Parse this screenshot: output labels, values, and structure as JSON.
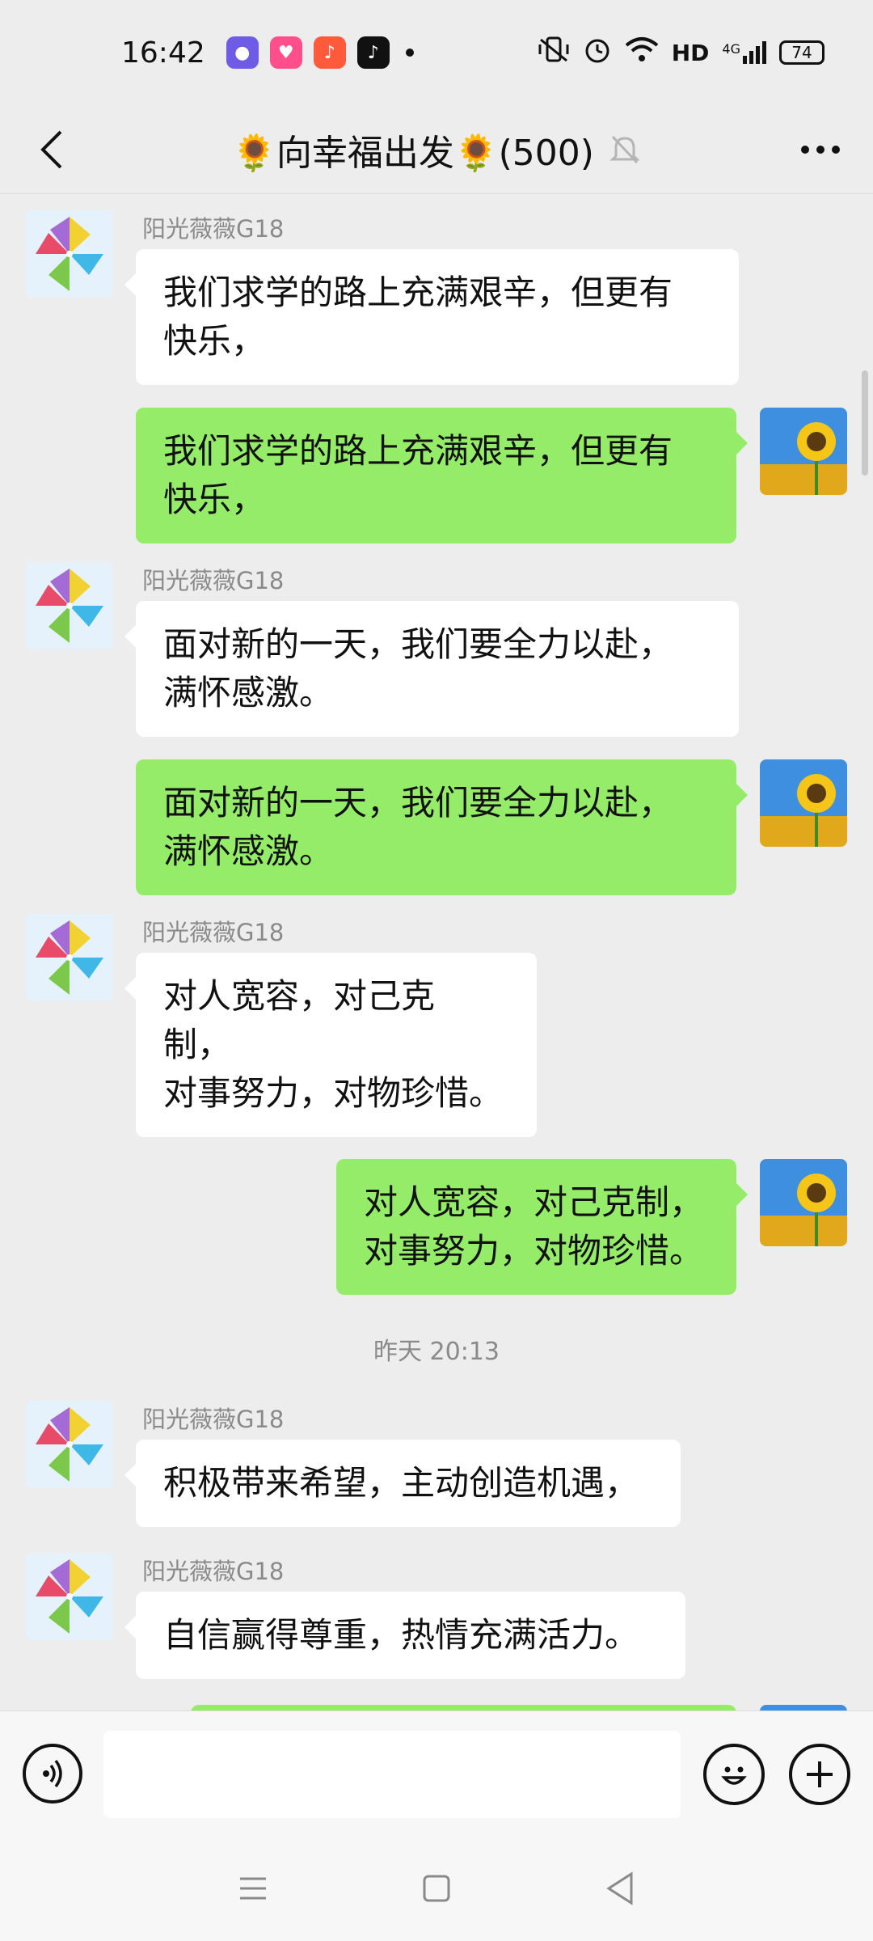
{
  "status_bar": {
    "time": "16:42",
    "notifications": [
      {
        "icon": "purple-app-icon",
        "color": "#6e5ce6"
      },
      {
        "icon": "pink-app-icon",
        "color": "#ff4f8b"
      },
      {
        "icon": "music-app-icon",
        "color": "#ff5a3c"
      },
      {
        "icon": "tiktok-icon",
        "color": "#111111"
      }
    ],
    "network_label": "HD",
    "signal_label": "4G",
    "battery": "74"
  },
  "header": {
    "title": "🌻向幸福出发🌻(500)",
    "back_icon": "chevron-left-icon",
    "mute_icon": "bell-muted-icon",
    "more_icon": "more-dots-icon"
  },
  "messages": [
    {
      "side": "left",
      "sender": "阳光薇薇G18",
      "text": "我们求学的路上充满艰辛，但更有\n快乐，"
    },
    {
      "side": "right",
      "text": "我们求学的路上充满艰辛，但更有\n快乐，"
    },
    {
      "side": "left",
      "sender": "阳光薇薇G18",
      "text": "面对新的一天，我们要全力以赴，\n满怀感激。"
    },
    {
      "side": "right",
      "text": "面对新的一天，我们要全力以赴，\n满怀感激。"
    },
    {
      "side": "left",
      "sender": "阳光薇薇G18",
      "text": "对人宽容，对己克\n制，\n对事努力，对物珍惜。"
    },
    {
      "side": "right",
      "text": "对人宽容，对己克制，\n对事努力，对物珍惜。"
    },
    {
      "type": "timestamp",
      "text": "昨天 20:13"
    },
    {
      "side": "left",
      "sender": "阳光薇薇G18",
      "text": "积极带来希望，主动创造机遇，"
    },
    {
      "side": "left",
      "sender": "阳光薇薇G18",
      "text": "自信赢得尊重，热情充满活力。"
    }
  ],
  "input_bar": {
    "placeholder": "",
    "voice_icon": "voice-icon",
    "emoji_icon": "emoji-icon",
    "plus_icon": "plus-icon"
  },
  "nav_bar": {
    "menu_icon": "menu-icon",
    "home_icon": "home-icon",
    "back_icon": "back-triangle-icon"
  },
  "colors": {
    "background": "#ededed",
    "bubble_green": "#95ec69",
    "bubble_white": "#ffffff",
    "meta_text": "#8a8a8a"
  }
}
